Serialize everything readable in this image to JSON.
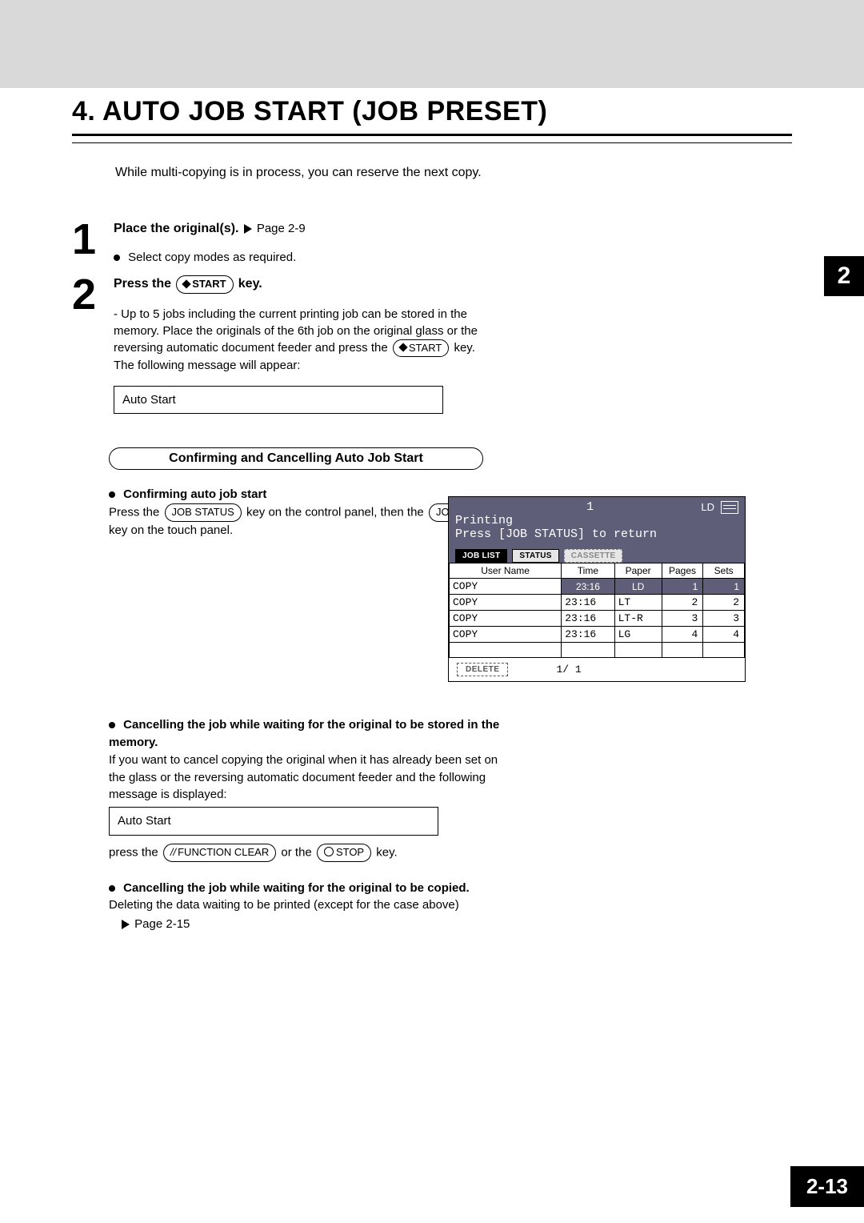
{
  "title": "4. AUTO JOB START (JOB PRESET)",
  "intro": "While multi-copying is in process, you can reserve the next copy.",
  "side_tab": "2",
  "page_number": "2-13",
  "step1": {
    "num": "1",
    "head": "Place the original(s).",
    "page_ref": "Page 2-9",
    "sub": "Select copy modes as required."
  },
  "step2": {
    "num": "2",
    "head_prefix": "Press the",
    "start_key": "START",
    "head_suffix": "key.",
    "body": "- Up to 5 jobs including the current printing job can be stored in the memory. Place the originals of the 6th job on the original glass or the reversing automatic document feeder and press the ",
    "body2": " key. The following message will appear:",
    "box": "Auto Start"
  },
  "section_heading": "Confirming and Cancelling Auto Job Start",
  "confirm": {
    "head": "Confirming auto job start",
    "line1a": "Press the ",
    "job_status_key": "JOB STATUS",
    "line1b": " key on the control panel, then the ",
    "job_list_key": "JOB LIST",
    "line1c": " key on the touch panel."
  },
  "cancel_store": {
    "head": "Cancelling the job while waiting for the original to be stored in the memory.",
    "body": "If you want to cancel copying the original when it has already been set on the glass or the reversing automatic document feeder and the following message is displayed:",
    "box": "Auto Start",
    "after1": "press the ",
    "fc_key": "FUNCTION CLEAR",
    "after2": " or the ",
    "stop_key": "STOP",
    "after3": " key."
  },
  "cancel_copy": {
    "head": "Cancelling the job while waiting for the original to be copied.",
    "body": "Deleting the data waiting to be printed (except for the case above)",
    "page_ref": "Page 2-15"
  },
  "screen": {
    "top_num": "1",
    "ld": "LD",
    "line1": "Printing",
    "line2": "Press [JOB STATUS] to return",
    "tabs": {
      "job_list": "JOB LIST",
      "status": "STATUS",
      "cassette": "CASSETTE"
    },
    "headers": {
      "user": "User Name",
      "time": "Time",
      "paper": "Paper",
      "pages": "Pages",
      "sets": "Sets"
    },
    "rows": [
      {
        "user": "COPY",
        "time": "23:16",
        "paper": "LD",
        "pages": "1",
        "sets": "1",
        "highlight": true
      },
      {
        "user": "COPY",
        "time": "23:16",
        "paper": "LT",
        "pages": "2",
        "sets": "2",
        "highlight": false
      },
      {
        "user": "COPY",
        "time": "23:16",
        "paper": "LT-R",
        "pages": "3",
        "sets": "3",
        "highlight": false
      },
      {
        "user": "COPY",
        "time": "23:16",
        "paper": "LG",
        "pages": "4",
        "sets": "4",
        "highlight": false
      }
    ],
    "delete": "DELETE",
    "page_ind": "1/ 1"
  }
}
